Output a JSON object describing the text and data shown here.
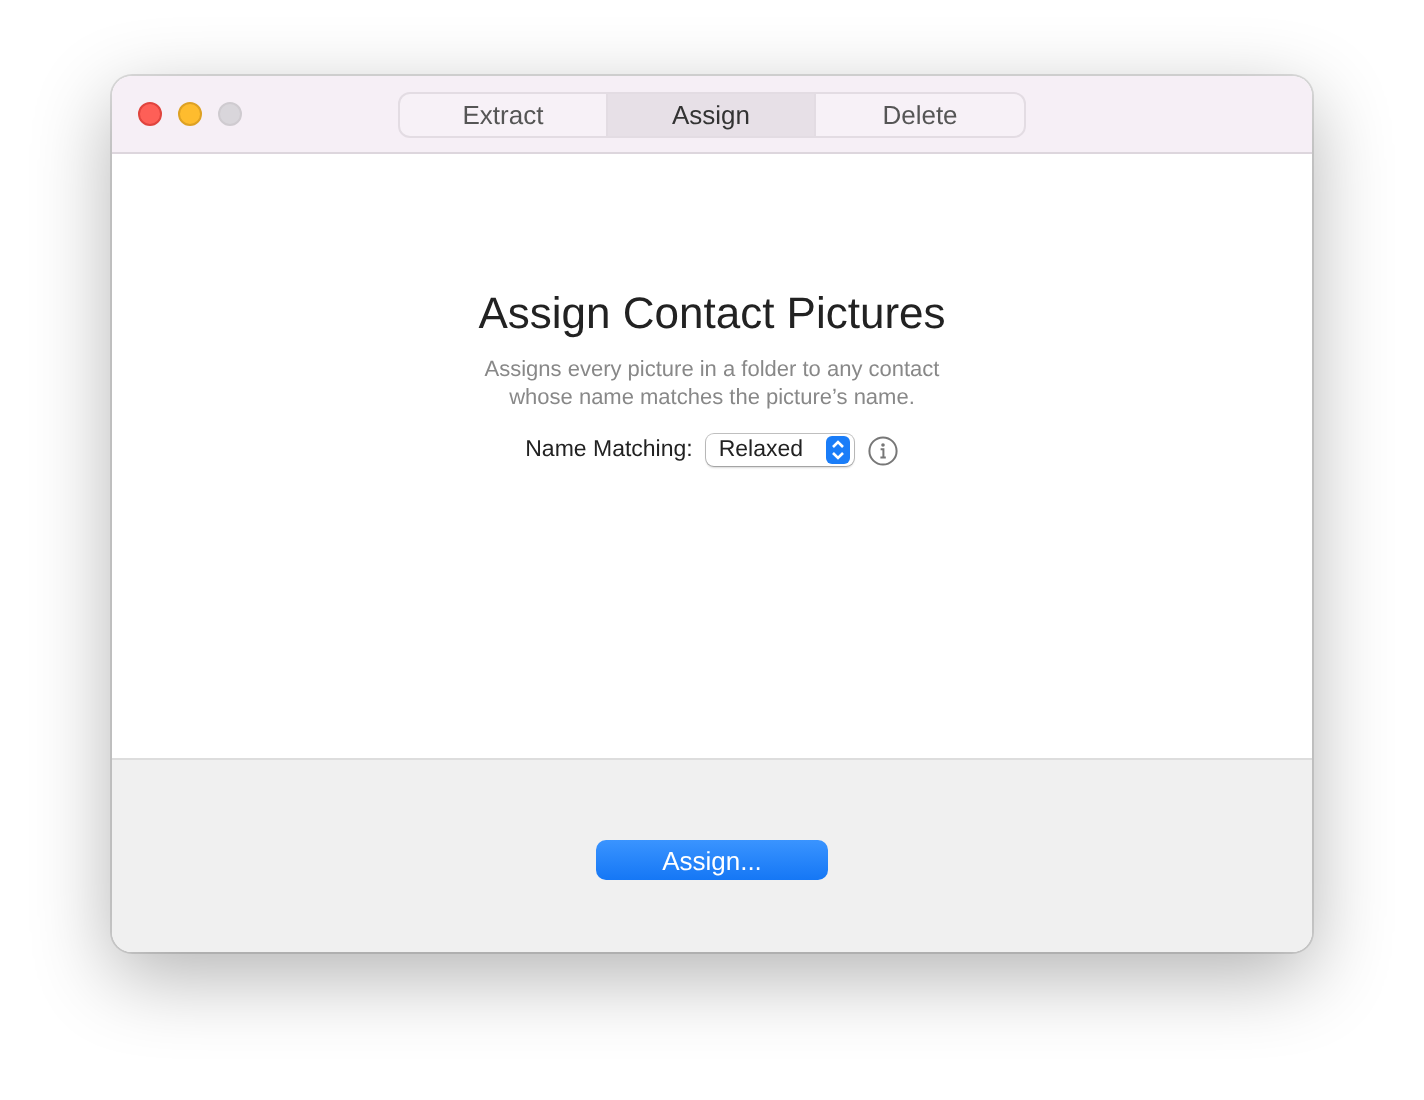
{
  "window": {
    "controls": [
      {
        "kind": "close",
        "color": "#fe5f57"
      },
      {
        "kind": "minimize",
        "color": "#febc2e"
      },
      {
        "kind": "zoom",
        "color": "#d9d6db"
      }
    ]
  },
  "tabs": [
    {
      "label": "Extract",
      "selected": false
    },
    {
      "label": "Assign",
      "selected": true
    },
    {
      "label": "Delete",
      "selected": false
    }
  ],
  "heading": "Assign Contact Pictures",
  "description": [
    "Assigns every picture in a folder to any contact",
    "whose name matches the picture’s name."
  ],
  "name_matching": {
    "label": "Name Matching:",
    "value": "Relaxed"
  },
  "action_button": "Assign..."
}
